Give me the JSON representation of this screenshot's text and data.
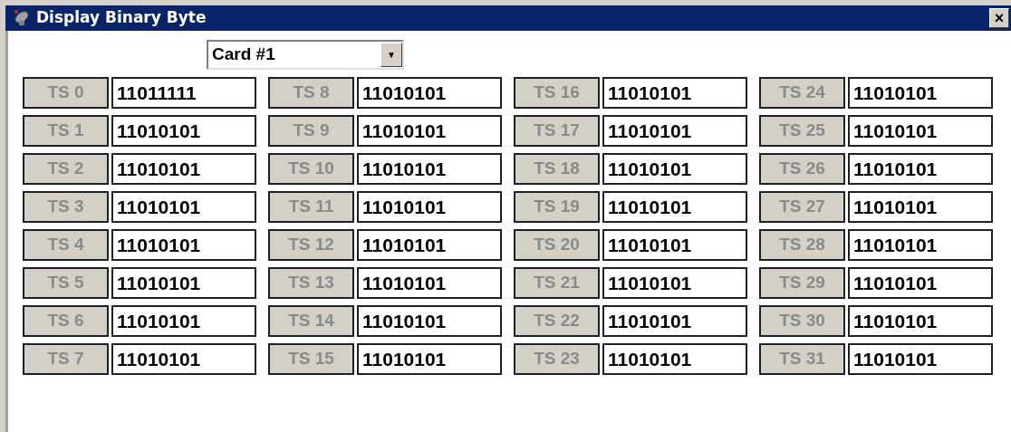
{
  "window": {
    "title": "Display Binary Byte",
    "close": "×"
  },
  "card_select": {
    "value": "Card #1",
    "arrow": "▼"
  },
  "slots": [
    {
      "label": "TS 0",
      "value": "11011111",
      "disabled": true
    },
    {
      "label": "TS 1",
      "value": "11010101",
      "disabled": true
    },
    {
      "label": "TS 2",
      "value": "11010101",
      "disabled": true
    },
    {
      "label": "TS 3",
      "value": "11010101",
      "disabled": true
    },
    {
      "label": "TS 4",
      "value": "11010101",
      "disabled": true
    },
    {
      "label": "TS 5",
      "value": "11010101",
      "disabled": true
    },
    {
      "label": "TS 6",
      "value": "11010101",
      "disabled": true
    },
    {
      "label": "TS 7",
      "value": "11010101",
      "disabled": true
    },
    {
      "label": "TS 8",
      "value": "11010101",
      "disabled": true
    },
    {
      "label": "TS 9",
      "value": "11010101",
      "disabled": true
    },
    {
      "label": "TS 10",
      "value": "11010101",
      "disabled": true
    },
    {
      "label": "TS 11",
      "value": "11010101",
      "disabled": true
    },
    {
      "label": "TS 12",
      "value": "11010101",
      "disabled": true
    },
    {
      "label": "TS 13",
      "value": "11010101",
      "disabled": true
    },
    {
      "label": "TS 14",
      "value": "11010101",
      "disabled": true
    },
    {
      "label": "TS 15",
      "value": "11010101",
      "disabled": true
    },
    {
      "label": "TS 16",
      "value": "11010101",
      "disabled": true
    },
    {
      "label": "TS 17",
      "value": "11010101",
      "disabled": true
    },
    {
      "label": "TS 18",
      "value": "11010101",
      "disabled": true
    },
    {
      "label": "TS 19",
      "value": "11010101",
      "disabled": true
    },
    {
      "label": "TS 20",
      "value": "11010101",
      "disabled": true
    },
    {
      "label": "TS 21",
      "value": "11010101",
      "disabled": true
    },
    {
      "label": "TS 22",
      "value": "11010101",
      "disabled": true
    },
    {
      "label": "TS 23",
      "value": "11010101",
      "disabled": true
    },
    {
      "label": "TS 24",
      "value": "11010101",
      "disabled": true
    },
    {
      "label": "TS 25",
      "value": "11010101",
      "disabled": true
    },
    {
      "label": "TS 26",
      "value": "11010101",
      "disabled": true
    },
    {
      "label": "TS 27",
      "value": "11010101",
      "disabled": true
    },
    {
      "label": "TS 28",
      "value": "11010101",
      "disabled": true
    },
    {
      "label": "TS 29",
      "value": "11010101",
      "disabled": true
    },
    {
      "label": "TS 30",
      "value": "11010101",
      "disabled": true
    },
    {
      "label": "TS 31",
      "value": "11010101",
      "disabled": true
    }
  ]
}
